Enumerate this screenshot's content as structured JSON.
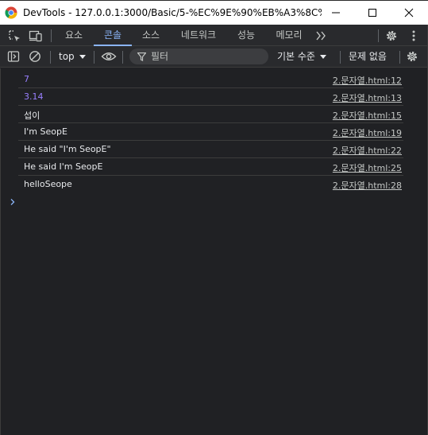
{
  "window": {
    "title": "DevTools - 127.0.0.1:3000/Basic/5-%EC%9E%90%EB%A3%8C%ED%..."
  },
  "tabs": [
    {
      "label": "요소",
      "active": false
    },
    {
      "label": "콘솔",
      "active": true
    },
    {
      "label": "소스",
      "active": false
    },
    {
      "label": "네트워크",
      "active": false
    },
    {
      "label": "성능",
      "active": false
    },
    {
      "label": "메모리",
      "active": false
    }
  ],
  "toolbar": {
    "context": "top",
    "filter_placeholder": "필터",
    "levels": "기본 수준",
    "issues": "문제 없음"
  },
  "messages": [
    {
      "text": "7",
      "type": "number",
      "source": "2.문자열.html:12"
    },
    {
      "text": "3.14",
      "type": "number",
      "source": "2.문자열.html:13"
    },
    {
      "text": "섭이",
      "type": "string",
      "source": "2.문자열.html:15"
    },
    {
      "text": "I'm SeopE",
      "type": "string",
      "source": "2.문자열.html:19"
    },
    {
      "text": "He said \"I'm SeopE\"",
      "type": "string",
      "source": "2.문자열.html:22"
    },
    {
      "text": "He said I'm SeopE",
      "type": "string",
      "source": "2.문자열.html:25"
    },
    {
      "text": "helloSeope",
      "type": "string",
      "source": "2.문자열.html:28"
    }
  ],
  "colors": {
    "background": "#202124",
    "accent": "#8ab4f8",
    "number": "#9980ff"
  }
}
